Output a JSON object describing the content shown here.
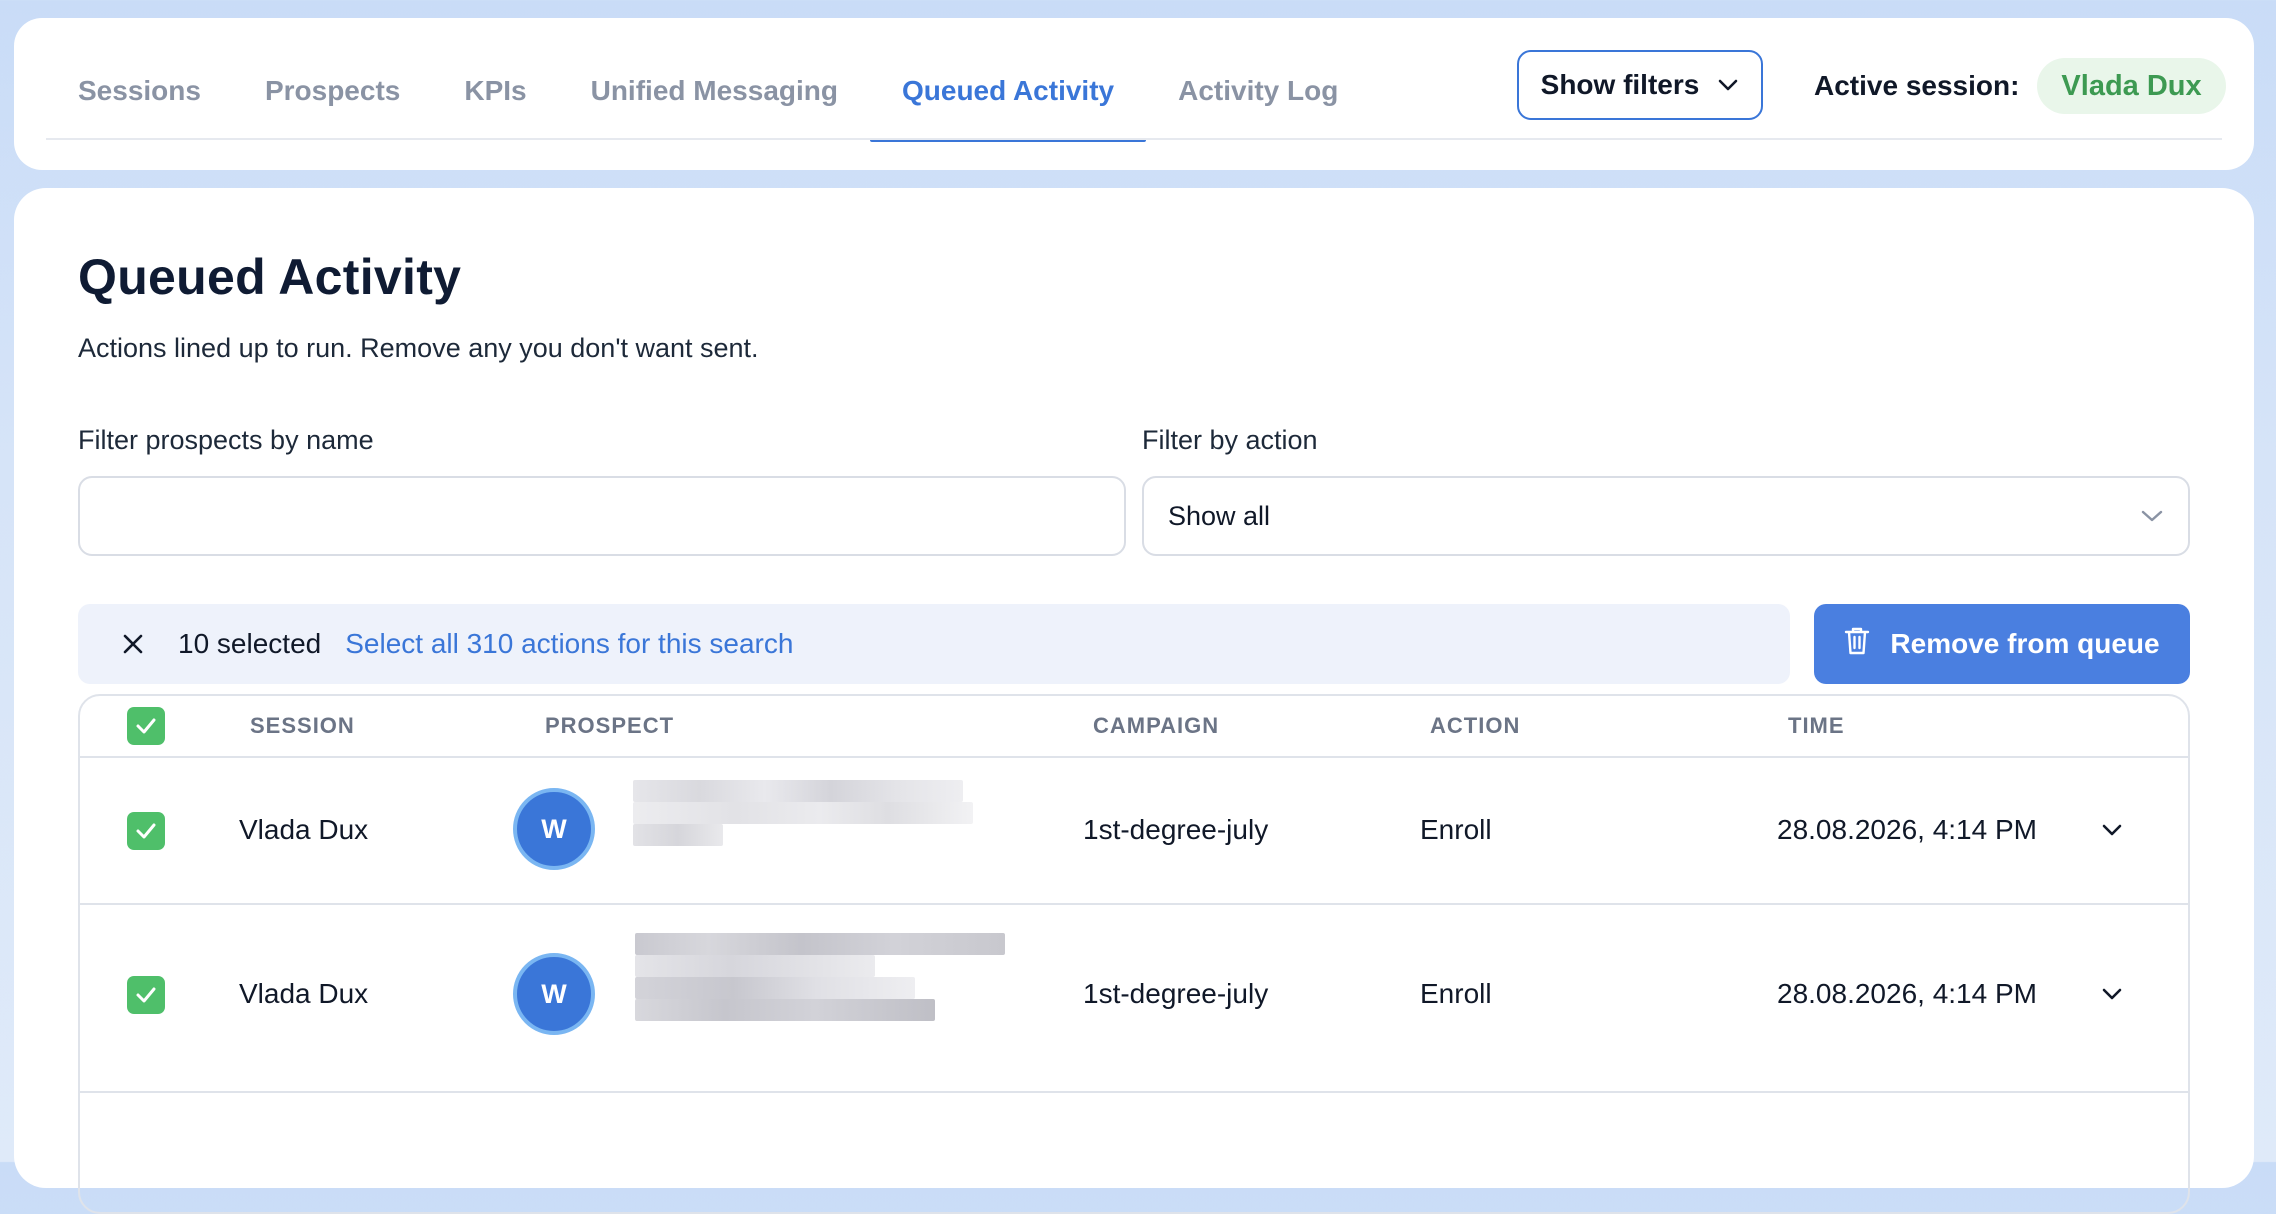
{
  "tabs": [
    {
      "label": "Sessions",
      "active": false
    },
    {
      "label": "Prospects",
      "active": false
    },
    {
      "label": "KPIs",
      "active": false
    },
    {
      "label": "Unified Messaging",
      "active": false
    },
    {
      "label": "Queued Activity",
      "active": true
    },
    {
      "label": "Activity Log",
      "active": false
    }
  ],
  "header": {
    "show_filters_label": "Show filters",
    "active_session_label": "Active session:",
    "active_session_name": "Vlada Dux"
  },
  "page": {
    "title": "Queued Activity",
    "subtitle": "Actions lined up to run. Remove any you don't want sent."
  },
  "filters": {
    "name_label": "Filter prospects by name",
    "name_value": "",
    "name_placeholder": "",
    "action_label": "Filter by action",
    "action_value": "Show all"
  },
  "selection": {
    "count_text": "10 selected",
    "select_all_text": "Select all 310 actions for this search",
    "remove_label": "Remove from queue"
  },
  "table": {
    "columns": [
      "SESSION",
      "PROSPECT",
      "CAMPAIGN",
      "ACTION",
      "TIME"
    ],
    "rows": [
      {
        "checked": true,
        "session": "Vlada Dux",
        "avatar": "W",
        "campaign": "1st-degree-july",
        "action": "Enroll",
        "time": "28.08.2026, 4:14 PM"
      },
      {
        "checked": true,
        "session": "Vlada Dux",
        "avatar": "W",
        "campaign": "1st-degree-july",
        "action": "Enroll",
        "time": "28.08.2026, 4:14 PM"
      }
    ]
  },
  "colors": {
    "accent": "#3a76d8",
    "checkbox": "#4fbf6a",
    "active_pill_bg": "#e9f6ea",
    "active_pill_text": "#3d9a52"
  }
}
